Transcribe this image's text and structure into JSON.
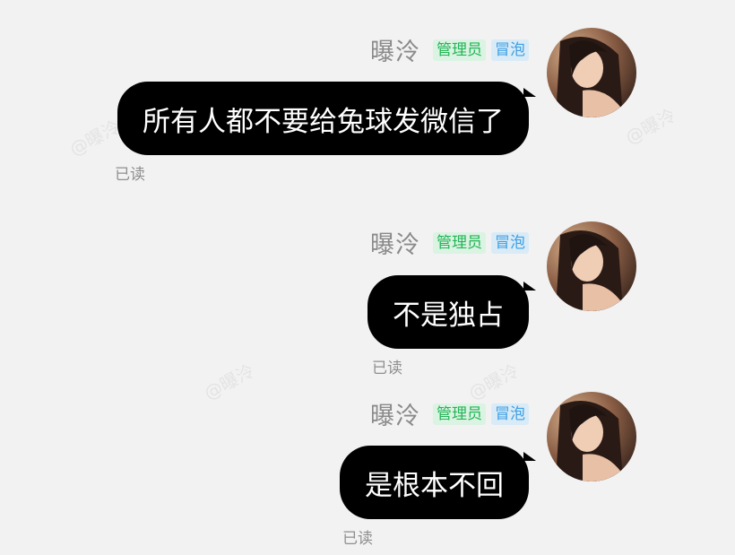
{
  "watermark": "@曝泠",
  "messages": [
    {
      "sender": "曝泠",
      "badges": [
        "管理员",
        "冒泡"
      ],
      "text": "所有人都不要给兔球发微信了",
      "status": "已读"
    },
    {
      "sender": "曝泠",
      "badges": [
        "管理员",
        "冒泡"
      ],
      "text": "不是独占",
      "status": "已读"
    },
    {
      "sender": "曝泠",
      "badges": [
        "管理员",
        "冒泡"
      ],
      "text": "是根本不回",
      "status": "已读"
    }
  ],
  "colors": {
    "background": "#f2f2f2",
    "bubble": "#000000",
    "admin_badge": "#22b556",
    "bubble_badge": "#3d9fe3"
  }
}
